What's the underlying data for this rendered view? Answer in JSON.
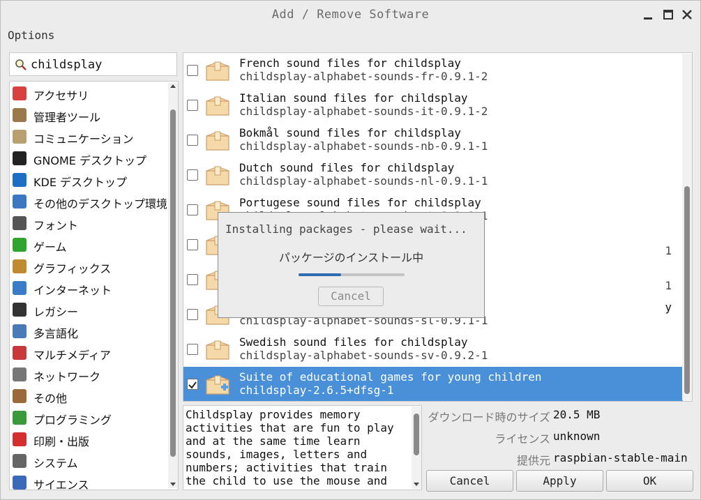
{
  "window": {
    "title": "Add / Remove Software"
  },
  "menu": {
    "options_label": "Options"
  },
  "search": {
    "value": "childsplay"
  },
  "categories": [
    {
      "label": "アクセサリ",
      "icon": "scissors-icon",
      "color": "#d94040"
    },
    {
      "label": "管理者ツール",
      "icon": "admin-tools-icon",
      "color": "#9a7a4a"
    },
    {
      "label": "コミュニケーション",
      "icon": "communication-icon",
      "color": "#b8a070"
    },
    {
      "label": "GNOME デスクトップ",
      "icon": "gnome-foot-icon",
      "color": "#222222"
    },
    {
      "label": "KDE デスクトップ",
      "icon": "kde-icon",
      "color": "#1d6fc4"
    },
    {
      "label": "その他のデスクトップ環境",
      "icon": "desktop-icon",
      "color": "#3a78c2"
    },
    {
      "label": "フォント",
      "icon": "font-icon",
      "color": "#555555"
    },
    {
      "label": "ゲーム",
      "icon": "game-invader-icon",
      "color": "#2fa52f"
    },
    {
      "label": "グラフィックス",
      "icon": "paintbrush-icon",
      "color": "#c08a30"
    },
    {
      "label": "インターネット",
      "icon": "globe-icon",
      "color": "#3a7cc8"
    },
    {
      "label": "レガシー",
      "icon": "floppy-disk-icon",
      "color": "#333333"
    },
    {
      "label": "多言語化",
      "icon": "localization-icon",
      "color": "#4a7ab8"
    },
    {
      "label": "マルチメディア",
      "icon": "multimedia-icon",
      "color": "#c83a3a"
    },
    {
      "label": "ネットワーク",
      "icon": "network-icon",
      "color": "#777777"
    },
    {
      "label": "その他",
      "icon": "box-icon",
      "color": "#9a6a3a"
    },
    {
      "label": "プログラミング",
      "icon": "programming-icon",
      "color": "#3a9a3a"
    },
    {
      "label": "印刷・出版",
      "icon": "print-publish-icon",
      "color": "#d32f2f"
    },
    {
      "label": "システム",
      "icon": "gear-icon",
      "color": "#666666"
    },
    {
      "label": "サイエンス",
      "icon": "science-icon",
      "color": "#3a6ab8"
    }
  ],
  "packages": [
    {
      "name": "French sound files for childsplay",
      "version": "childsplay-alphabet-sounds-fr-0.9.1-2",
      "checked": false
    },
    {
      "name": "Italian sound files for childsplay",
      "version": "childsplay-alphabet-sounds-it-0.9.1-2",
      "checked": false
    },
    {
      "name": "Bokmål sound files for childsplay",
      "version": "childsplay-alphabet-sounds-nb-0.9.1-1",
      "checked": false
    },
    {
      "name": "Dutch sound files for childsplay",
      "version": "childsplay-alphabet-sounds-nl-0.9.1-1",
      "checked": false
    },
    {
      "name": "Portugese sound files for childsplay",
      "version": "childsplay-alphabet-sounds-pt-0.9.1-1",
      "checked": false
    },
    {
      "name": "",
      "version": "1",
      "checked": false
    },
    {
      "name": "",
      "version": "1",
      "checked": false
    },
    {
      "name": "y",
      "version": "childsplay-alphabet-sounds-sl-0.9.1-1",
      "checked": false
    },
    {
      "name": "Swedish sound files for childsplay",
      "version": "childsplay-alphabet-sounds-sv-0.9.2-1",
      "checked": false
    },
    {
      "name": "Suite of educational games for young children",
      "version": "childsplay-2.6.5+dfsg-1",
      "checked": true,
      "selected": true
    }
  ],
  "description": "Childsplay provides memory\nactivities that are fun to play\nand at the same time learn\nsounds, images, letters and\nnumbers; activities that train\nthe child to use the mouse and",
  "details": {
    "download_size_label": "ダウンロード時のサイズ",
    "download_size_value": "20.5 MB",
    "license_label": "ライセンス",
    "license_value": "unknown",
    "provider_label": "提供元",
    "provider_value": "raspbian-stable-main"
  },
  "buttons": {
    "cancel": "Cancel",
    "apply": "Apply",
    "ok": "OK"
  },
  "dialog": {
    "title": "Installing packages - please wait...",
    "message": "パッケージのインストール中",
    "progress": 0.4,
    "cancel": "Cancel"
  },
  "colors": {
    "selection": "#4a90d9",
    "progress": "#2f6bb3"
  }
}
